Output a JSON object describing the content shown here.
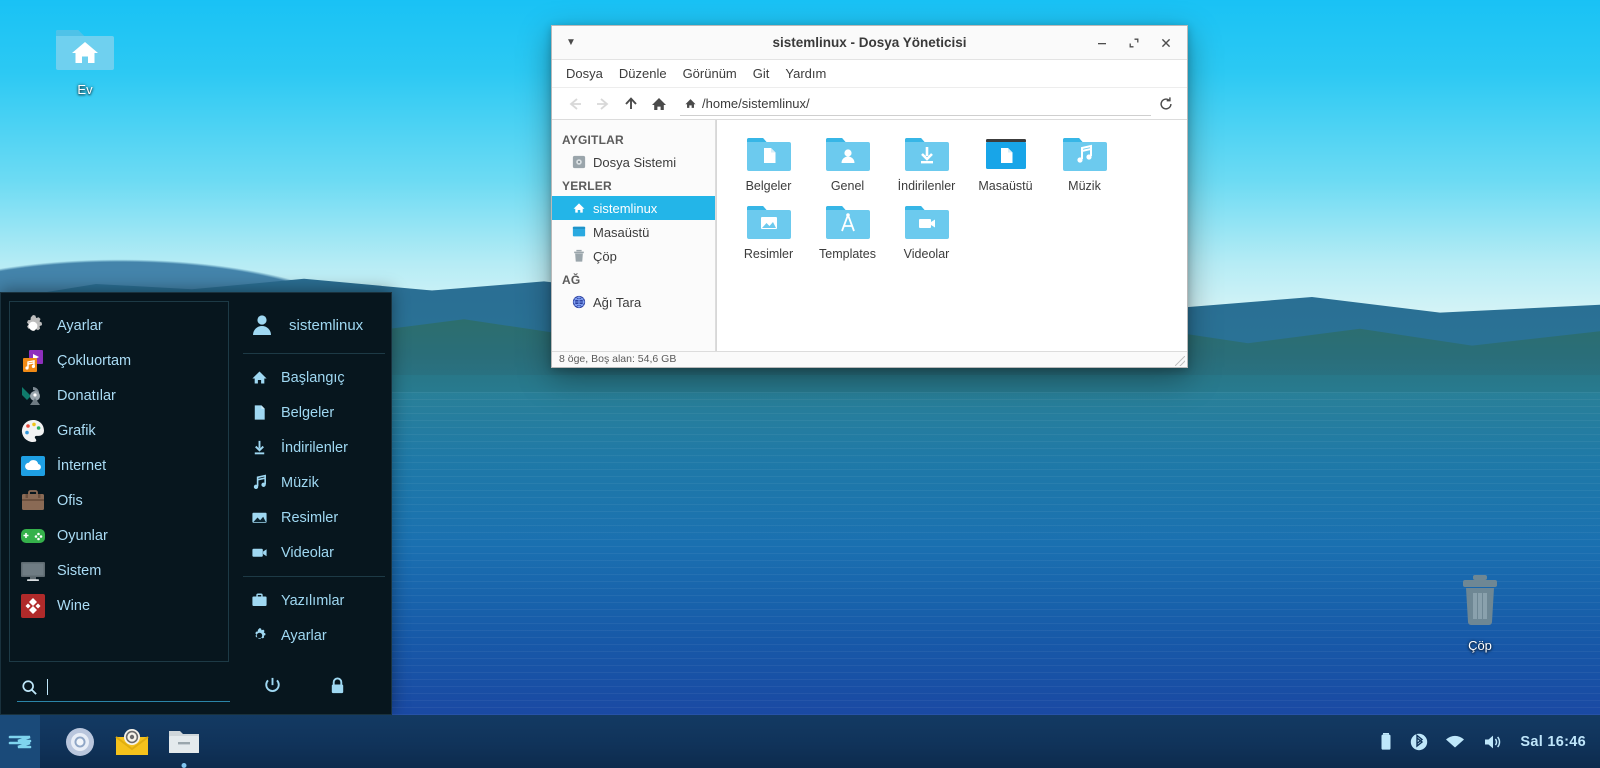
{
  "desktop": {
    "icons": [
      {
        "name": "home",
        "label": "Ev",
        "icon": "home-folder-icon"
      },
      {
        "name": "trash",
        "label": "Çöp",
        "icon": "trash-icon"
      }
    ]
  },
  "filemanager": {
    "title": "sistemlinux - Dosya Yöneticisi",
    "window_menu_icon": "chevron-down-icon",
    "window_buttons": [
      {
        "name": "minimize",
        "icon": "minimize-icon",
        "glyph": "–"
      },
      {
        "name": "maximize",
        "icon": "maximize-icon",
        "glyph": "⤢"
      },
      {
        "name": "close",
        "icon": "close-icon",
        "glyph": "✕"
      }
    ],
    "menubar": [
      "Dosya",
      "Düzenle",
      "Görünüm",
      "Git",
      "Yardım"
    ],
    "toolbar": {
      "back": "back-arrow-icon",
      "forward": "forward-arrow-icon",
      "up": "up-arrow-icon",
      "home": "home-icon",
      "reload": "reload-icon"
    },
    "path": "/home/sistemlinux/",
    "sidebar": [
      {
        "type": "header",
        "label": "AYGITLAR"
      },
      {
        "type": "item",
        "label": "Dosya Sistemi",
        "icon": "disk-icon",
        "active": false
      },
      {
        "type": "header",
        "label": "YERLER"
      },
      {
        "type": "item",
        "label": "sistemlinux",
        "icon": "home-icon",
        "active": true
      },
      {
        "type": "item",
        "label": "Masaüstü",
        "icon": "desktop-icon",
        "active": false
      },
      {
        "type": "item",
        "label": "Çöp",
        "icon": "trash-icon",
        "active": false
      },
      {
        "type": "header",
        "label": "AĞ"
      },
      {
        "type": "item",
        "label": "Ağı Tara",
        "icon": "network-globe-icon",
        "active": false
      }
    ],
    "files": [
      {
        "label": "Belgeler",
        "icon": "documents-folder-icon"
      },
      {
        "label": "Genel",
        "icon": "public-folder-icon"
      },
      {
        "label": "İndirilenler",
        "icon": "downloads-folder-icon"
      },
      {
        "label": "Masaüstü",
        "icon": "desktop-folder-icon"
      },
      {
        "label": "Müzik",
        "icon": "music-folder-icon"
      },
      {
        "label": "Resimler",
        "icon": "pictures-folder-icon"
      },
      {
        "label": "Templates",
        "icon": "templates-folder-icon"
      },
      {
        "label": "Videolar",
        "icon": "videos-folder-icon"
      }
    ],
    "status": "8 öge, Boş alan: 54,6 GB"
  },
  "appmenu": {
    "categories": [
      {
        "label": "Ayarlar",
        "icon": "gear-icon"
      },
      {
        "label": "Çokluortam",
        "icon": "multimedia-icon"
      },
      {
        "label": "Donatılar",
        "icon": "accessories-icon"
      },
      {
        "label": "Grafik",
        "icon": "graphics-palette-icon"
      },
      {
        "label": "İnternet",
        "icon": "internet-cloud-icon"
      },
      {
        "label": "Ofis",
        "icon": "office-briefcase-icon"
      },
      {
        "label": "Oyunlar",
        "icon": "games-gamepad-icon"
      },
      {
        "label": "Sistem",
        "icon": "system-monitor-icon"
      },
      {
        "label": "Wine",
        "icon": "wine-icon"
      }
    ],
    "user": {
      "label": "sistemlinux",
      "icon": "user-avatar-icon"
    },
    "places_top": [
      {
        "label": "Başlangıç",
        "icon": "home-icon"
      },
      {
        "label": "Belgeler",
        "icon": "document-icon"
      },
      {
        "label": "İndirilenler",
        "icon": "download-icon"
      },
      {
        "label": "Müzik",
        "icon": "music-note-icon"
      },
      {
        "label": "Resimler",
        "icon": "picture-icon"
      },
      {
        "label": "Videolar",
        "icon": "video-camera-icon"
      }
    ],
    "places_bottom": [
      {
        "label": "Yazılımlar",
        "icon": "software-briefcase-icon"
      },
      {
        "label": "Ayarlar",
        "icon": "gear-icon"
      }
    ],
    "search": {
      "value": "",
      "placeholder": "",
      "icon": "search-icon"
    },
    "actions": [
      {
        "name": "power",
        "icon": "power-icon"
      },
      {
        "name": "lock",
        "icon": "lock-icon"
      }
    ]
  },
  "taskbar": {
    "start": {
      "icon": "zorin-start-icon"
    },
    "launchers": [
      {
        "name": "browser",
        "icon": "chromium-icon",
        "running": false
      },
      {
        "name": "mail",
        "icon": "mail-icon",
        "running": false
      },
      {
        "name": "files",
        "icon": "file-manager-icon",
        "running": true
      }
    ],
    "tray": [
      {
        "name": "battery",
        "icon": "battery-icon"
      },
      {
        "name": "bluetooth",
        "icon": "bluetooth-icon"
      },
      {
        "name": "network",
        "icon": "wifi-icon"
      },
      {
        "name": "volume",
        "icon": "volume-icon"
      }
    ],
    "clock": "Sal 16:46"
  },
  "colors": {
    "accent": "#23b5e8",
    "menu_bg": "#07161e",
    "menu_text": "#9fd8f2",
    "taskbar_bg": "#10335a",
    "folder": "#5ec8ee"
  }
}
